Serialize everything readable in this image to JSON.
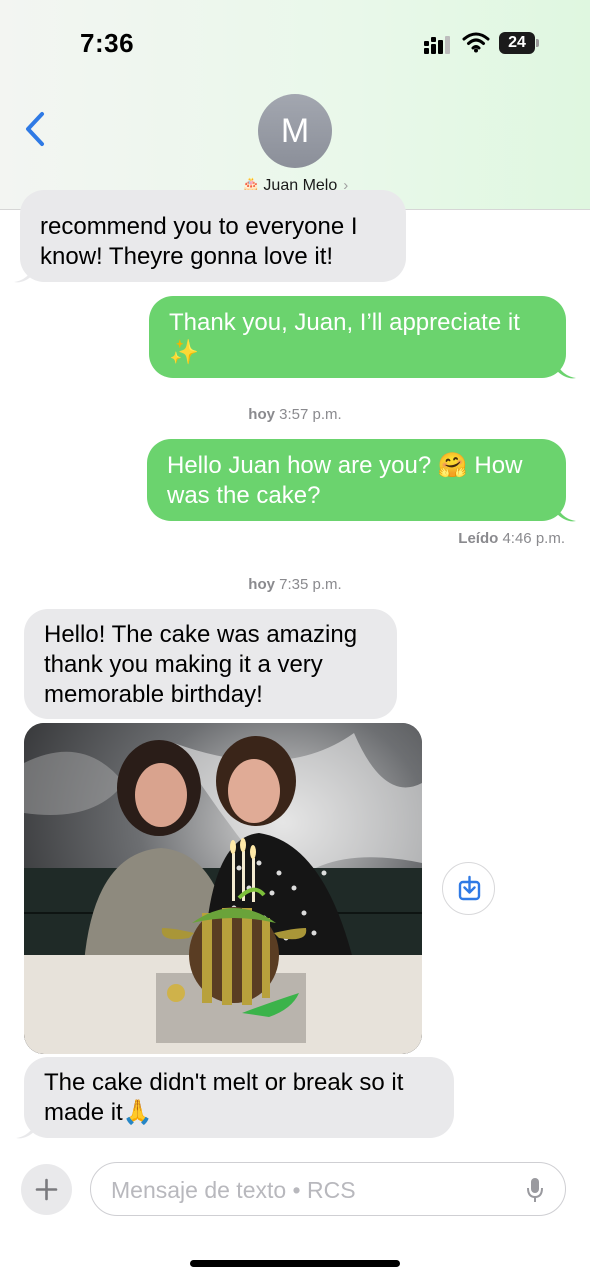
{
  "status_bar": {
    "time": "7:36",
    "battery": "24"
  },
  "header": {
    "avatar_initial": "M",
    "contact_name": "Juan Melo",
    "contact_emoji": "🎂"
  },
  "messages": [
    {
      "direction": "incoming",
      "lines": [
        "recommend you to everyone I",
        "know! Theyre gonna love it!"
      ]
    },
    {
      "direction": "outgoing",
      "lines": [
        "Thank you, Juan, I’ll appreciate it",
        "✨"
      ]
    },
    {
      "direction": "outgoing",
      "lines": [
        "Hello Juan how are you? 🤗 How",
        "was the cake?"
      ]
    },
    {
      "direction": "incoming",
      "lines": [
        "Hello! The cake was amazing",
        "thank you making it a very",
        "memorable birthday!"
      ]
    },
    {
      "direction": "incoming",
      "lines": [
        "The cake didn't melt or break so it",
        "made it🙏"
      ]
    }
  ],
  "timestamps": [
    {
      "day": "hoy",
      "time": "3:57 p.m."
    },
    {
      "day": "hoy",
      "time": "7:35 p.m."
    }
  ],
  "read_receipt": {
    "label": "Leído",
    "time": "4:46 p.m."
  },
  "composer": {
    "placeholder": "Mensaje de texto • RCS"
  },
  "icons": [
    "signal-icon",
    "wifi-icon",
    "battery-icon",
    "back-chevron-icon",
    "chevron-right-icon",
    "save-download-icon",
    "plus-icon",
    "microphone-icon"
  ],
  "colors": {
    "outgoing_bubble": "#6bd36e",
    "incoming_bubble": "#e9e9eb",
    "accent": "#2f7ae5"
  }
}
